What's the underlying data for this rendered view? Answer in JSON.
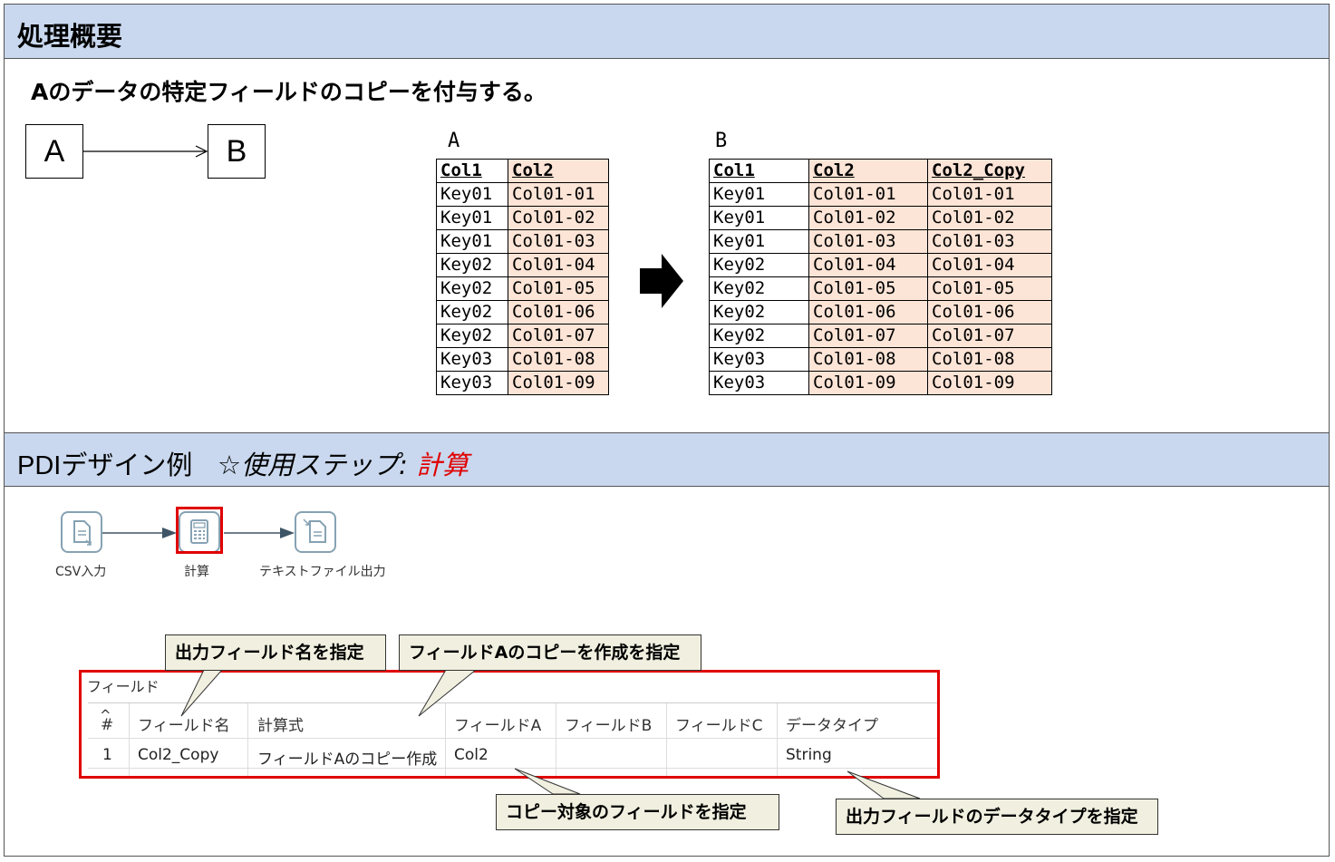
{
  "section1": {
    "title": "処理概要",
    "description": "Aのデータの特定フィールドのコピーを付与する。",
    "box_a": "A",
    "box_b": "B"
  },
  "table_a": {
    "label": "A",
    "headers": [
      "Col1",
      "Col2"
    ],
    "rows": [
      [
        "Key01",
        "Col01-01"
      ],
      [
        "Key01",
        "Col01-02"
      ],
      [
        "Key01",
        "Col01-03"
      ],
      [
        "Key02",
        "Col01-04"
      ],
      [
        "Key02",
        "Col01-05"
      ],
      [
        "Key02",
        "Col01-06"
      ],
      [
        "Key02",
        "Col01-07"
      ],
      [
        "Key03",
        "Col01-08"
      ],
      [
        "Key03",
        "Col01-09"
      ]
    ]
  },
  "table_b": {
    "label": "B",
    "headers": [
      "Col1",
      "Col2",
      "Col2_Copy"
    ],
    "rows": [
      [
        "Key01",
        "Col01-01",
        "Col01-01"
      ],
      [
        "Key01",
        "Col01-02",
        "Col01-02"
      ],
      [
        "Key01",
        "Col01-03",
        "Col01-03"
      ],
      [
        "Key02",
        "Col01-04",
        "Col01-04"
      ],
      [
        "Key02",
        "Col01-05",
        "Col01-05"
      ],
      [
        "Key02",
        "Col01-06",
        "Col01-06"
      ],
      [
        "Key02",
        "Col01-07",
        "Col01-07"
      ],
      [
        "Key03",
        "Col01-08",
        "Col01-08"
      ],
      [
        "Key03",
        "Col01-09",
        "Col01-09"
      ]
    ]
  },
  "section2": {
    "title_prefix": "PDIデザイン例",
    "title_step": "☆使用ステップ:",
    "title_step_name": "計算"
  },
  "pdi_steps": [
    {
      "label": "CSV入力",
      "icon": "csv-input-icon"
    },
    {
      "label": "計算",
      "icon": "calculator-icon"
    },
    {
      "label": "テキストファイル出力",
      "icon": "text-file-output-icon"
    }
  ],
  "callouts": {
    "field_name": "出力フィールド名を指定",
    "field_a_copy": "フィールドAのコピーを作成を指定",
    "copy_target": "コピー対象のフィールドを指定",
    "data_type": "出力フィールドのデータタイプを指定"
  },
  "grid": {
    "title": "フィールド",
    "headers": [
      "#",
      "フィールド名",
      "計算式",
      "フィールドA",
      "フィールドB",
      "フィールドC",
      "データタイプ"
    ],
    "row": [
      "1",
      "Col2_Copy",
      "フィールドAのコピー作成",
      "Col2",
      "",
      "",
      "String"
    ]
  },
  "colors": {
    "band": "#c9d8ee",
    "value_cell": "#fce4d6",
    "highlight": "#e00000",
    "callout_bg": "#f1f0e0"
  }
}
